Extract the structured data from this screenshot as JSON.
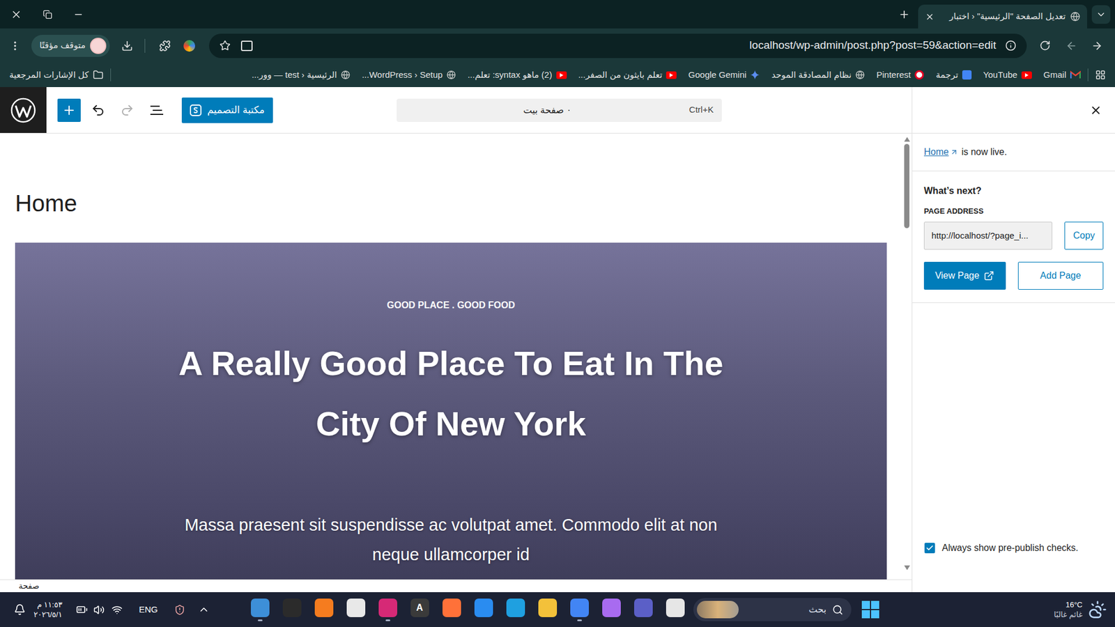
{
  "browser": {
    "tabs": [
      {
        "label": "تعديل الصفحة \"الرئيسية\" ‹ اختبار",
        "selected": true
      }
    ],
    "profile": "متوقف مؤقتًا",
    "url": "localhost/wp-admin/post.php?post=59&action=edit",
    "bookmarks": [
      {
        "label": "Gmail",
        "kind": "gmail"
      },
      {
        "label": "YouTube",
        "kind": "youtube"
      },
      {
        "label": "ترجمة",
        "kind": "translate"
      },
      {
        "label": "Pinterest",
        "kind": "pinterest"
      },
      {
        "label": "نظام المصادقة الموحد",
        "kind": "globe"
      },
      {
        "label": "Google Gemini",
        "kind": "gemini"
      },
      {
        "label": "تعلم بايثون من الصفر...",
        "kind": "youtube"
      },
      {
        "label": "(2) ماهو syntax: تعلم...",
        "kind": "youtube"
      },
      {
        "label": "WordPress › Setup...",
        "kind": "globe"
      },
      {
        "label": "الرئيسية ‹ test — وور...",
        "kind": "globe"
      }
    ],
    "all_bookmarks": "كل الإشارات المرجعية"
  },
  "editor": {
    "pattern_library": "مكتبة التصميم",
    "command_bar": {
      "title": "صفحة بيت",
      "separator": "·",
      "shortcut": "Ctrl+K"
    },
    "page_title": "Home",
    "cover": {
      "eyebrow": "GOOD PLACE . GOOD FOOD",
      "heading": "A Really Good Place To Eat In The City Of New York",
      "body": "Massa praesent sit suspendisse ac volutpat amet. Commodo elit at non neque ullamcorper id"
    },
    "scrollbar": {
      "level": 0.2
    },
    "breadcrumb": "صفحة"
  },
  "sidebar": {
    "live_link": "Home",
    "live_text": "is now live.",
    "whats_next": "What’s next?",
    "address_label": "PAGE ADDRESS",
    "address_value": "http://localhost/?page_i...",
    "buttons": [
      "Copy",
      "View Page",
      "Add Page"
    ],
    "checkbox": {
      "label": "Always show pre-publish checks.",
      "checked": true
    }
  },
  "taskbar": {
    "time": "١١:٥٣ م",
    "date": "٢٠٢٦/٥/١",
    "language": "ENG",
    "search_placeholder": "بحث",
    "apps": [
      {
        "color": "#3d8fd8",
        "running": true
      },
      {
        "color": "#2b2b2b",
        "running": false
      },
      {
        "color": "#f57c1f",
        "running": false
      },
      {
        "color": "#e8e8e8",
        "running": false
      },
      {
        "color": "#d62976",
        "running": true
      },
      {
        "color": "#3a3a3a",
        "running": false,
        "glyph": "A"
      },
      {
        "color": "#ff7139",
        "running": false
      },
      {
        "color": "#2a8cf0",
        "running": false
      },
      {
        "color": "#1fa0e0",
        "running": false
      },
      {
        "color": "#f3c13a",
        "running": false
      },
      {
        "color": "#4285f4",
        "running": true
      },
      {
        "color": "#a86bf0",
        "running": false
      },
      {
        "color": "#5b5fc7",
        "running": false
      },
      {
        "color": "#e6e6e6",
        "running": false
      }
    ],
    "weather": {
      "temp": "16°C",
      "text": "غائم غالبًا"
    }
  }
}
